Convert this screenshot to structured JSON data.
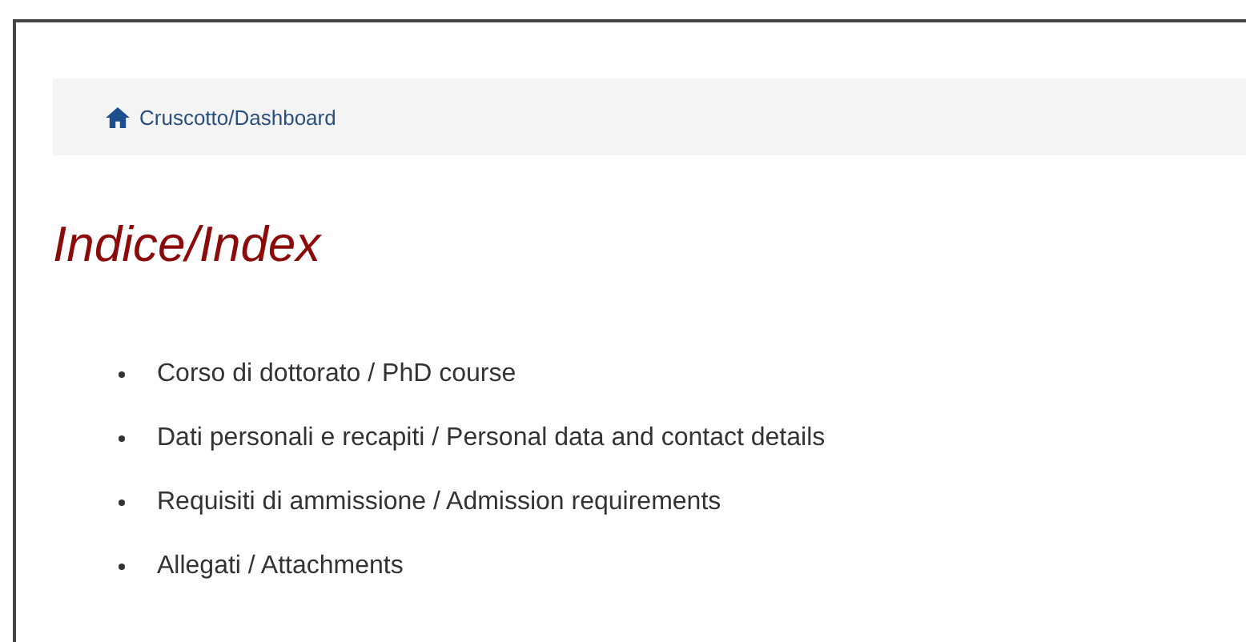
{
  "breadcrumb": {
    "label": "Cruscotto/Dashboard"
  },
  "title": "Indice/Index",
  "index_items": [
    {
      "label": "Corso di dottorato / PhD course"
    },
    {
      "label": "Dati personali e recapiti / Personal data and contact details"
    },
    {
      "label": "Requisiti di ammissione / Admission requirements"
    },
    {
      "label": "Allegati / Attachments"
    }
  ]
}
